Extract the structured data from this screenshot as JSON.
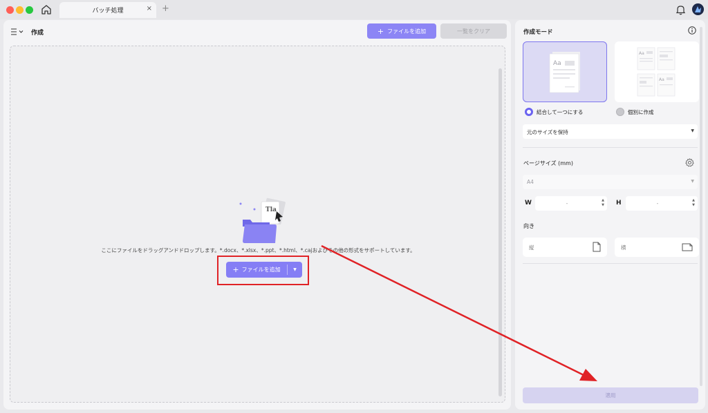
{
  "titlebar": {
    "tab_label": "バッチ処理",
    "tab_close": "×",
    "tab_add": "+"
  },
  "left": {
    "title": "作成",
    "add_file_label": "ファイルを追加",
    "clear_label": "一覧をクリア",
    "drop_text": "ここにファイルをドラッグアンドドロップします。*.docx、*.xlsx、*.ppt、*.html、*.cajおよびその他の形式をサポートしています。",
    "center_add_label": "ファイルを追加",
    "plus": "+",
    "caret": "▼"
  },
  "right": {
    "title": "作成モード",
    "mode_combine": "結合して一つにする",
    "mode_individual": "個別に作成",
    "size_option": "元のサイズを保持",
    "page_size_label": "ページサイズ (mm)",
    "page_size_value": "A4",
    "w_label": "W",
    "h_label": "H",
    "w_value": "-",
    "h_value": "-",
    "orientation_label": "向き",
    "portrait_label": "縦",
    "landscape_label": "横",
    "apply_label": "適用",
    "dropdown_arrow": "▼"
  },
  "colors": {
    "accent": "#857ef5",
    "highlight_box": "#e02226",
    "annotation_arrow": "#e02226"
  }
}
